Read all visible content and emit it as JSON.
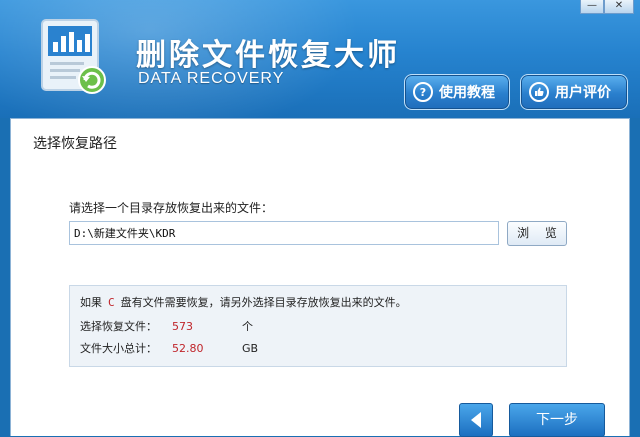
{
  "window": {
    "minimize_label": "—",
    "close_label": "✕"
  },
  "header": {
    "title": "删除文件恢复大师",
    "subtitle": "DATA RECOVERY",
    "tutorial_label": "使用教程",
    "review_label": "用户评价"
  },
  "page": {
    "section_title": "选择恢复路径"
  },
  "path": {
    "prompt": "请选择一个目录存放恢复出来的文件：",
    "value": "D:\\新建文件夹\\KDR",
    "browse_label": "浏 览"
  },
  "info": {
    "line_prefix": "如果",
    "drive": "C",
    "line_suffix": "盘有文件需要恢复，请另外选择目录存放恢复出来的文件。",
    "count_label": "选择恢复文件：",
    "count_value": "573",
    "count_unit": "个",
    "size_label": "文件大小总计：",
    "size_value": "52.80",
    "size_unit": "GB"
  },
  "nav": {
    "next_label": "下一步"
  },
  "icons": {
    "tutorial": "question-icon",
    "review": "thumbs-up-icon",
    "back": "arrow-left-icon",
    "logo": "document-chart-logo-icon"
  },
  "colors": {
    "header_blue": "#2683cf",
    "accent_red": "#c0252b",
    "button_blue": "#1c6fc0"
  }
}
